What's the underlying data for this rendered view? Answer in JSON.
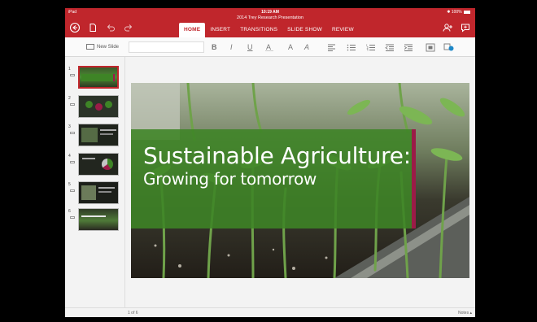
{
  "status_bar": {
    "device": "iPad",
    "time": "10:19 AM",
    "battery": "100%"
  },
  "document": {
    "title": "2014 Trey Research Presentation"
  },
  "tabs": [
    {
      "label": "HOME",
      "active": true
    },
    {
      "label": "INSERT",
      "active": false
    },
    {
      "label": "TRANSITIONS",
      "active": false
    },
    {
      "label": "SLIDE SHOW",
      "active": false
    },
    {
      "label": "REVIEW",
      "active": false
    }
  ],
  "ribbon": {
    "new_slide_label": "New Slide",
    "bold": "B",
    "italic": "I",
    "underline": "U",
    "font_color": "A",
    "clear_format": "A"
  },
  "slide": {
    "title": "Sustainable Agriculture:",
    "subtitle": "Growing for tomorrow"
  },
  "thumbnails": [
    {
      "number": "1",
      "selected": true
    },
    {
      "number": "2",
      "selected": false
    },
    {
      "number": "3",
      "selected": false
    },
    {
      "number": "4",
      "selected": false
    },
    {
      "number": "5",
      "selected": false
    },
    {
      "number": "6",
      "selected": false
    }
  ],
  "footer": {
    "page_indicator": "1 of 6",
    "notes_label": "Notes"
  },
  "colors": {
    "brand_red": "#c0262c",
    "slide_green": "#3e8426",
    "accent_magenta": "#9b1b47"
  },
  "icons": [
    "back-icon",
    "new-document-icon",
    "undo-icon",
    "redo-icon",
    "share-icon",
    "comment-icon",
    "new-slide-icon",
    "bold-icon",
    "italic-icon",
    "underline-icon",
    "font-color-icon",
    "clear-format-icon",
    "align-left-icon",
    "bullets-icon",
    "numbering-icon",
    "outdent-icon",
    "indent-icon",
    "arrange-icon",
    "shape-fill-icon"
  ]
}
